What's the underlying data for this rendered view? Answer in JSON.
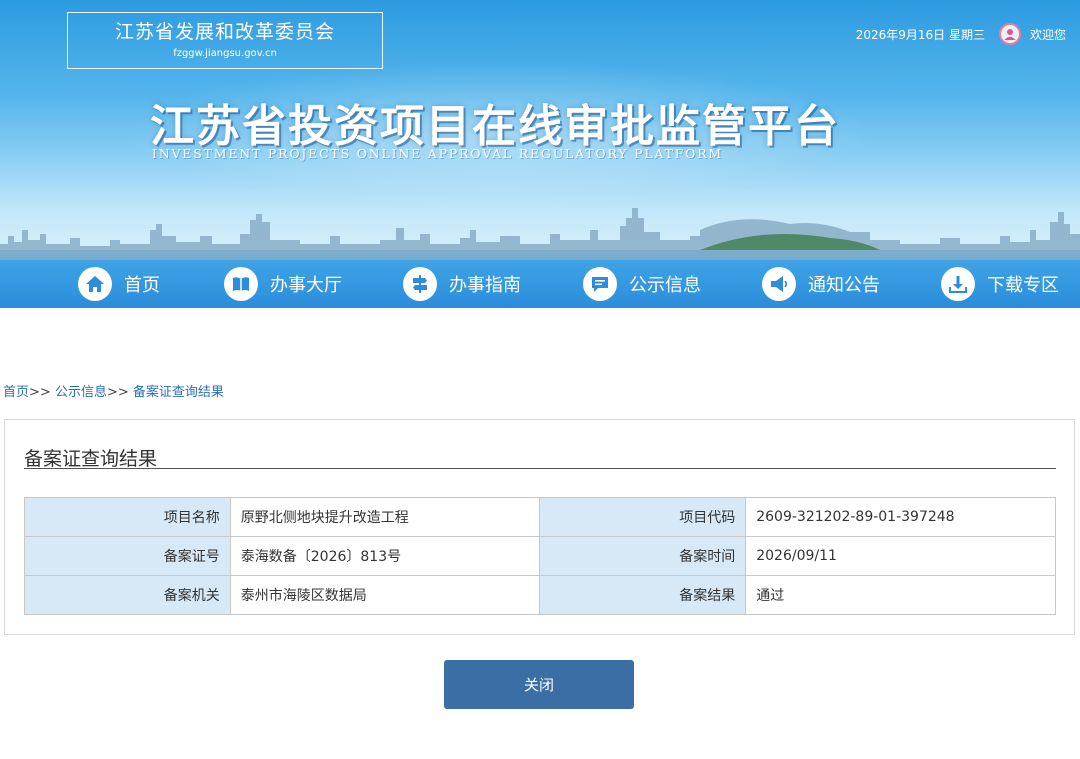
{
  "header": {
    "org_name": "江苏省发展和改革委员会",
    "org_domain": "fzggw.jiangsu.gov.cn",
    "date": "2026年9月16日 星期三",
    "welcome": "欢迎您",
    "platform_title": "江苏省投资项目在线审批监管平台",
    "platform_subtitle": "INVESTMENT PROJECTS ONLINE APPROVAL REGULATORY PLATFORM"
  },
  "nav": {
    "items": [
      {
        "label": "首页",
        "icon": "home-icon"
      },
      {
        "label": "办事大厅",
        "icon": "book-icon"
      },
      {
        "label": "办事指南",
        "icon": "signpost-icon"
      },
      {
        "label": "公示信息",
        "icon": "message-icon"
      },
      {
        "label": "通知公告",
        "icon": "megaphone-icon"
      },
      {
        "label": "下载专区",
        "icon": "download-icon"
      }
    ]
  },
  "breadcrumb": {
    "home": "首页",
    "sep": ">>",
    "section": "公示信息",
    "current": "备案证查询结果"
  },
  "panel": {
    "title": "备案证查询结果",
    "rows": [
      {
        "label1": "项目名称",
        "value1": "原野北侧地块提升改造工程",
        "label2": "项目代码",
        "value2": "2609-321202-89-01-397248"
      },
      {
        "label1": "备案证号",
        "value1": "泰海数备〔2026〕813号",
        "label2": "备案时间",
        "value2": "2026/09/11"
      },
      {
        "label1": "备案机关",
        "value1": "泰州市海陵区数据局",
        "label2": "备案结果",
        "value2": "通过"
      }
    ]
  },
  "actions": {
    "close_label": "关闭"
  },
  "colors": {
    "nav_bg": "#2b8ddb",
    "label_cell_bg": "#d7e8f6",
    "button_bg": "#3a6ea5",
    "link": "#2a6fb5"
  }
}
